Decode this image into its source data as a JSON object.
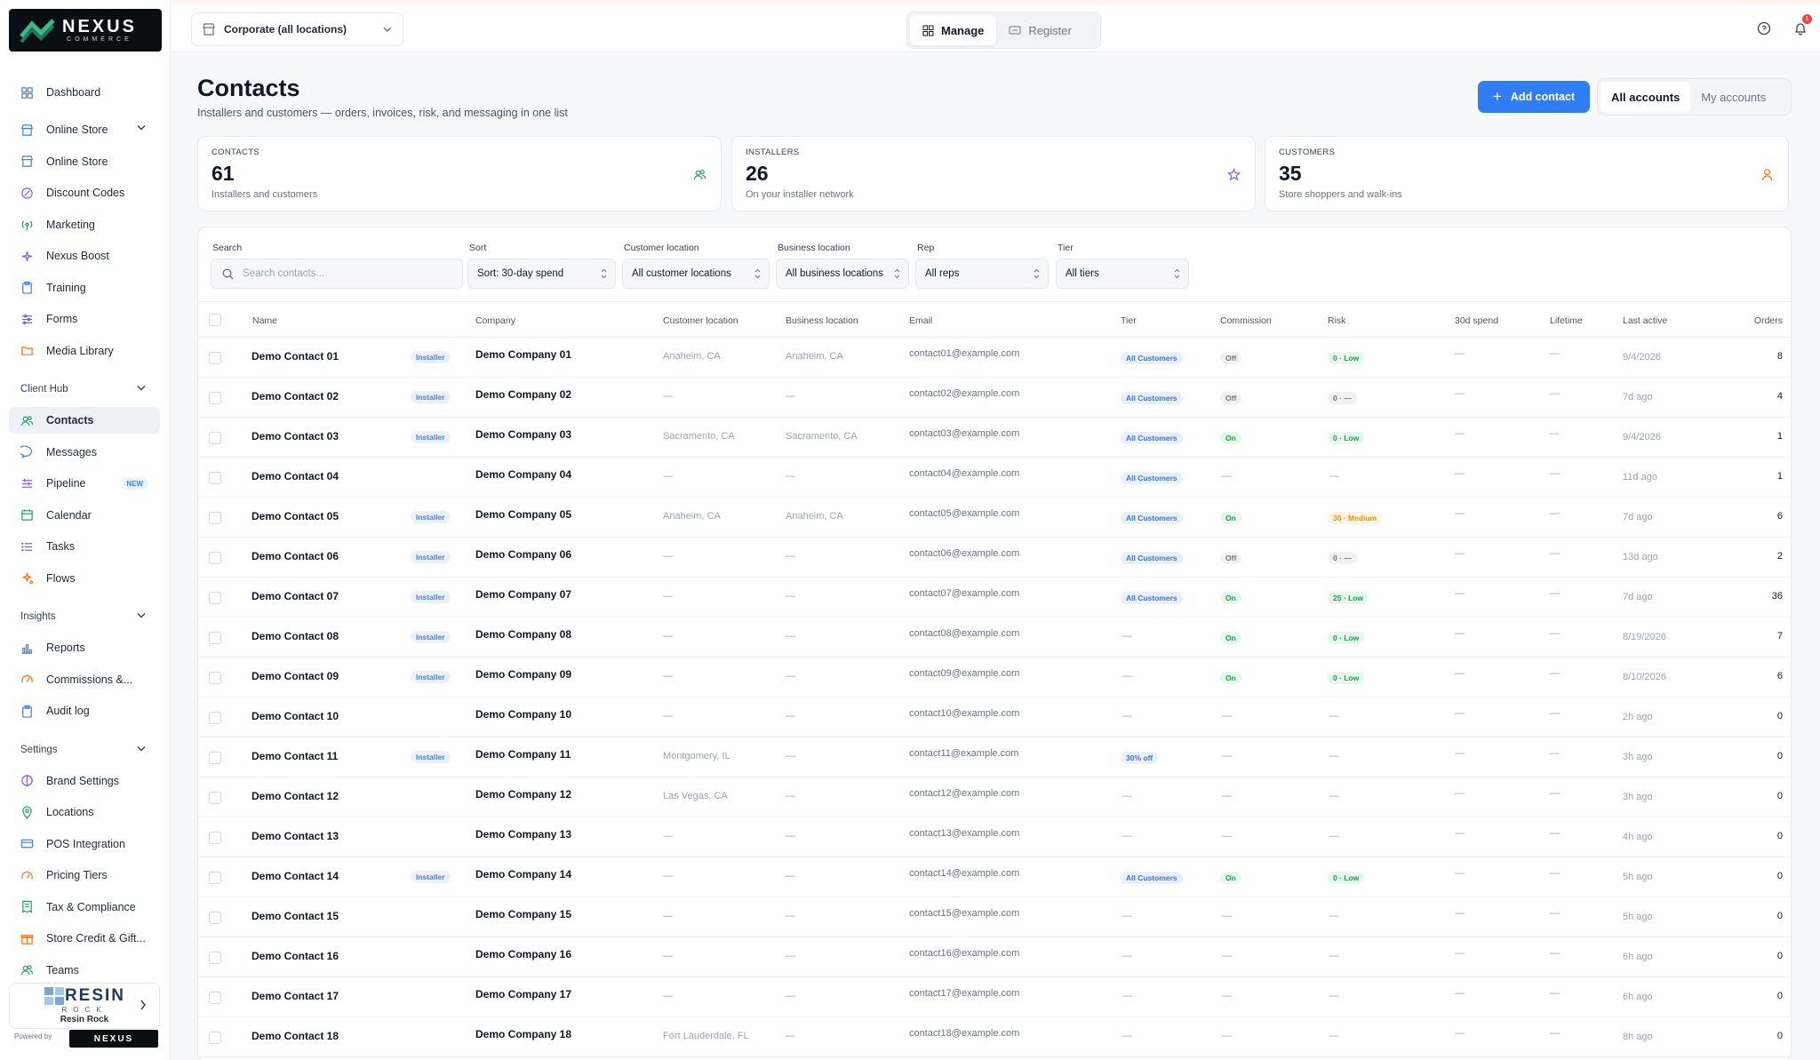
{
  "brand": {
    "name": "NEXUS",
    "tagline": "COMMERCE"
  },
  "sidebar": {
    "items_top": [
      {
        "label": "Dashboard",
        "icon": "grid-icon"
      },
      {
        "label": "Online Store",
        "icon": "store-icon",
        "chevron": true
      },
      {
        "label": "Online Store",
        "icon": "store-icon"
      },
      {
        "label": "Discount Codes",
        "icon": "discount-icon"
      },
      {
        "label": "Marketing",
        "icon": "broadcast-icon"
      },
      {
        "label": "Nexus Boost",
        "icon": "sparkle-icon"
      },
      {
        "label": "Training",
        "icon": "clipboard-icon"
      },
      {
        "label": "Forms",
        "icon": "sliders-icon"
      },
      {
        "label": "Media Library",
        "icon": "folder-icon"
      }
    ],
    "client_hub": {
      "title": "Client Hub",
      "items": [
        {
          "label": "Contacts",
          "icon": "users-icon",
          "active": true
        },
        {
          "label": "Messages",
          "icon": "chat-icon"
        },
        {
          "label": "Pipeline",
          "icon": "pipeline-icon",
          "badge": "NEW"
        },
        {
          "label": "Calendar",
          "icon": "calendar-icon"
        },
        {
          "label": "Tasks",
          "icon": "list-icon"
        },
        {
          "label": "Flows",
          "icon": "flow-icon"
        }
      ]
    },
    "insights": {
      "title": "Insights",
      "items": [
        {
          "label": "Reports",
          "icon": "bar-chart-icon"
        },
        {
          "label": "Commissions &...",
          "icon": "gauge-icon"
        },
        {
          "label": "Audit log",
          "icon": "clipboard-icon"
        }
      ]
    },
    "settings": {
      "title": "Settings",
      "items": [
        {
          "label": "Brand Settings",
          "icon": "brand-icon"
        },
        {
          "label": "Locations",
          "icon": "pin-icon"
        },
        {
          "label": "POS Integration",
          "icon": "card-icon"
        },
        {
          "label": "Pricing Tiers",
          "icon": "gauge-icon"
        },
        {
          "label": "Tax & Compliance",
          "icon": "receipt-icon"
        },
        {
          "label": "Store Credit & Gift...",
          "icon": "gift-icon"
        },
        {
          "label": "Teams",
          "icon": "users-icon"
        }
      ]
    },
    "store_card": {
      "logo_name": "RESIN",
      "logo_sub": "ROCK",
      "name": "Resin Rock"
    },
    "powered_by": "Powered by"
  },
  "topbar": {
    "location": "Corporate (all locations)",
    "modes": [
      "Manage",
      "Register"
    ],
    "notification_count": "1"
  },
  "page": {
    "title": "Contacts",
    "subtitle": "Installers and customers — orders, invoices, risk, and messaging in one list",
    "add_button": "Add contact",
    "account_tabs": [
      "All accounts",
      "My accounts"
    ]
  },
  "stats": [
    {
      "label": "CONTACTS",
      "value": "61",
      "desc": "Installers and customers",
      "icon": "users-icon",
      "color": "#22a06b"
    },
    {
      "label": "INSTALLERS",
      "value": "26",
      "desc": "On your installer network",
      "icon": "star-icon",
      "color": "#8b5cf6"
    },
    {
      "label": "CUSTOMERS",
      "value": "35",
      "desc": "Store shoppers and walk-ins",
      "icon": "person-icon",
      "color": "#f97316"
    }
  ],
  "filters": {
    "search_label": "Search",
    "search_placeholder": "Search contacts...",
    "sort_label": "Sort",
    "sort_value": "Sort: 30-day spend",
    "cust_loc_label": "Customer location",
    "cust_loc_value": "All customer locations",
    "bus_loc_label": "Business location",
    "bus_loc_value": "All business locations",
    "rep_label": "Rep",
    "rep_value": "All reps",
    "tier_label": "Tier",
    "tier_value": "All tiers"
  },
  "columns": [
    "Name",
    "Company",
    "Customer location",
    "Business location",
    "Email",
    "Tier",
    "Commission",
    "Risk",
    "30d spend",
    "Lifetime",
    "Last active",
    "Orders"
  ],
  "rows": [
    {
      "name": "Demo Contact 01",
      "installer": true,
      "company": "Demo Company 01",
      "cust_loc": "Anaheim, CA",
      "bus_loc": "Anaheim, CA",
      "email": "contact01@example.com",
      "tier": "All Customers",
      "commission": "Off",
      "risk": "0 · Low",
      "spend": "—",
      "lifetime": "—",
      "last": "9/4/2026",
      "orders": "8"
    },
    {
      "name": "Demo Contact 02",
      "installer": true,
      "company": "Demo Company 02",
      "cust_loc": "—",
      "bus_loc": "—",
      "email": "contact02@example.com",
      "tier": "All Customers",
      "commission": "Off",
      "risk": "0 · —",
      "spend": "—",
      "lifetime": "—",
      "last": "7d ago",
      "orders": "4"
    },
    {
      "name": "Demo Contact 03",
      "installer": true,
      "company": "Demo Company 03",
      "cust_loc": "Sacramento, CA",
      "bus_loc": "Sacramento, CA",
      "email": "contact03@example.com",
      "tier": "All Customers",
      "commission": "On",
      "risk": "0 · Low",
      "spend": "—",
      "lifetime": "—",
      "last": "9/4/2026",
      "orders": "1"
    },
    {
      "name": "Demo Contact 04",
      "installer": false,
      "company": "Demo Company 04",
      "cust_loc": "—",
      "bus_loc": "—",
      "email": "contact04@example.com",
      "tier": "All Customers",
      "commission": "—",
      "risk": "—",
      "spend": "—",
      "lifetime": "—",
      "last": "11d ago",
      "orders": "1"
    },
    {
      "name": "Demo Contact 05",
      "installer": true,
      "company": "Demo Company 05",
      "cust_loc": "Anaheim, CA",
      "bus_loc": "Anaheim, CA",
      "email": "contact05@example.com",
      "tier": "All Customers",
      "commission": "On",
      "risk": "30 · Medium",
      "spend": "—",
      "lifetime": "—",
      "last": "7d ago",
      "orders": "6"
    },
    {
      "name": "Demo Contact 06",
      "installer": true,
      "company": "Demo Company 06",
      "cust_loc": "—",
      "bus_loc": "—",
      "email": "contact06@example.com",
      "tier": "All Customers",
      "commission": "Off",
      "risk": "0 · —",
      "spend": "—",
      "lifetime": "—",
      "last": "13d ago",
      "orders": "2"
    },
    {
      "name": "Demo Contact 07",
      "installer": true,
      "company": "Demo Company 07",
      "cust_loc": "—",
      "bus_loc": "—",
      "email": "contact07@example.com",
      "tier": "All Customers",
      "commission": "On",
      "risk": "25 · Low",
      "spend": "—",
      "lifetime": "—",
      "last": "7d ago",
      "orders": "36"
    },
    {
      "name": "Demo Contact 08",
      "installer": true,
      "company": "Demo Company 08",
      "cust_loc": "—",
      "bus_loc": "—",
      "email": "contact08@example.com",
      "tier": "—",
      "commission": "On",
      "risk": "0 · Low",
      "spend": "—",
      "lifetime": "—",
      "last": "8/19/2026",
      "orders": "7"
    },
    {
      "name": "Demo Contact 09",
      "installer": true,
      "company": "Demo Company 09",
      "cust_loc": "—",
      "bus_loc": "—",
      "email": "contact09@example.com",
      "tier": "—",
      "commission": "On",
      "risk": "0 · Low",
      "spend": "—",
      "lifetime": "—",
      "last": "8/10/2026",
      "orders": "6"
    },
    {
      "name": "Demo Contact 10",
      "installer": false,
      "company": "Demo Company 10",
      "cust_loc": "—",
      "bus_loc": "—",
      "email": "contact10@example.com",
      "tier": "—",
      "commission": "—",
      "risk": "—",
      "spend": "—",
      "lifetime": "—",
      "last": "2h ago",
      "orders": "0"
    },
    {
      "name": "Demo Contact 11",
      "installer": true,
      "company": "Demo Company 11",
      "cust_loc": "Montgomery, IL",
      "bus_loc": "—",
      "email": "contact11@example.com",
      "tier": "30% off",
      "commission": "—",
      "risk": "—",
      "spend": "—",
      "lifetime": "—",
      "last": "3h ago",
      "orders": "0"
    },
    {
      "name": "Demo Contact 12",
      "installer": false,
      "company": "Demo Company 12",
      "cust_loc": "Las Vegas, CA",
      "bus_loc": "—",
      "email": "contact12@example.com",
      "tier": "—",
      "commission": "—",
      "risk": "—",
      "spend": "—",
      "lifetime": "—",
      "last": "3h ago",
      "orders": "0"
    },
    {
      "name": "Demo Contact 13",
      "installer": false,
      "company": "Demo Company 13",
      "cust_loc": "—",
      "bus_loc": "—",
      "email": "contact13@example.com",
      "tier": "—",
      "commission": "—",
      "risk": "—",
      "spend": "—",
      "lifetime": "—",
      "last": "4h ago",
      "orders": "0"
    },
    {
      "name": "Demo Contact 14",
      "installer": true,
      "company": "Demo Company 14",
      "cust_loc": "—",
      "bus_loc": "—",
      "email": "contact14@example.com",
      "tier": "All Customers",
      "commission": "On",
      "risk": "0 · Low",
      "spend": "—",
      "lifetime": "—",
      "last": "5h ago",
      "orders": "0"
    },
    {
      "name": "Demo Contact 15",
      "installer": false,
      "company": "Demo Company 15",
      "cust_loc": "—",
      "bus_loc": "—",
      "email": "contact15@example.com",
      "tier": "—",
      "commission": "—",
      "risk": "—",
      "spend": "—",
      "lifetime": "—",
      "last": "5h ago",
      "orders": "0"
    },
    {
      "name": "Demo Contact 16",
      "installer": false,
      "company": "Demo Company 16",
      "cust_loc": "—",
      "bus_loc": "—",
      "email": "contact16@example.com",
      "tier": "—",
      "commission": "—",
      "risk": "—",
      "spend": "—",
      "lifetime": "—",
      "last": "6h ago",
      "orders": "0"
    },
    {
      "name": "Demo Contact 17",
      "installer": false,
      "company": "Demo Company 17",
      "cust_loc": "—",
      "bus_loc": "—",
      "email": "contact17@example.com",
      "tier": "—",
      "commission": "—",
      "risk": "—",
      "spend": "—",
      "lifetime": "—",
      "last": "6h ago",
      "orders": "0"
    },
    {
      "name": "Demo Contact 18",
      "installer": false,
      "company": "Demo Company 18",
      "cust_loc": "Fort Lauderdale, FL",
      "bus_loc": "—",
      "email": "contact18@example.com",
      "tier": "—",
      "commission": "—",
      "risk": "—",
      "spend": "—",
      "lifetime": "—",
      "last": "8h ago",
      "orders": "0"
    }
  ],
  "installer_label": "Installer"
}
